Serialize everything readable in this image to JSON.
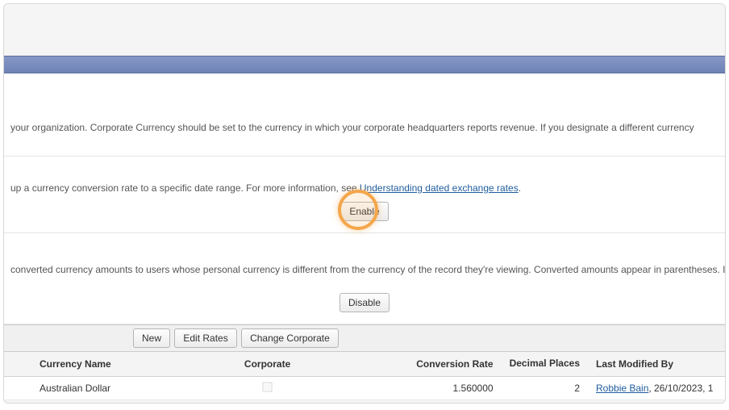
{
  "intro_text": "your organization. Corporate Currency should be set to the currency in which your corporate headquarters reports revenue. If you designate a different currency",
  "dated_text_prefix": "up a currency conversion rate to a specific date range. For more information, see ",
  "dated_link_label": "Understanding dated exchange rates",
  "dated_text_suffix": ".",
  "enable_btn": "Enable",
  "parenthetical_text": "converted currency amounts to users whose personal currency is different from the currency of the record they're viewing. Converted amounts appear in parentheses. If you dis",
  "disable_btn": "Disable",
  "toolbar": {
    "new_label": "New",
    "edit_rates_label": "Edit Rates",
    "change_corporate_label": "Change Corporate"
  },
  "table": {
    "headers": {
      "currency_name": "Currency Name",
      "corporate": "Corporate",
      "conversion_rate": "Conversion Rate",
      "decimal_places": "Decimal Places",
      "last_modified_by": "Last Modified By"
    },
    "rows": [
      {
        "currency_name": "Australian Dollar",
        "corporate": false,
        "conversion_rate": "1.560000",
        "decimal_places": "2",
        "last_modified_by_user": "Robbie Bain",
        "last_modified_by_date": ", 26/10/2023, 1"
      }
    ]
  }
}
